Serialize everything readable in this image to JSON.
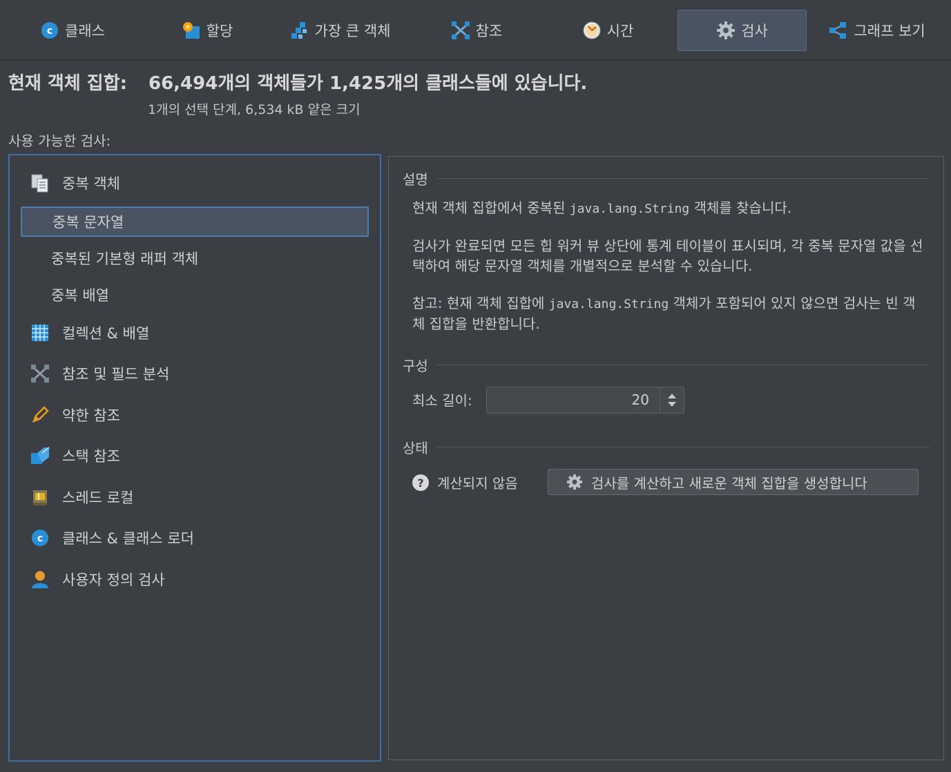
{
  "tabs": [
    {
      "label": "클래스",
      "icon": "class-c-icon",
      "active": false
    },
    {
      "label": "할당",
      "icon": "allocation-icon",
      "active": false
    },
    {
      "label": "가장 큰 객체",
      "icon": "biggest-objects-icon",
      "active": false
    },
    {
      "label": "참조",
      "icon": "references-icon",
      "active": false
    },
    {
      "label": "시간",
      "icon": "clock-icon",
      "active": false
    },
    {
      "label": "검사",
      "icon": "gear-icon",
      "active": true
    },
    {
      "label": "그래프 보기",
      "icon": "graph-icon",
      "active": false
    }
  ],
  "header": {
    "title_label": "현재 객체 집합:",
    "title_value": "66,494개의 객체들가 1,425개의 클래스들에 있습니다.",
    "subtitle": "1개의 선택 단계, 6,534 kB 얕은 크기",
    "available_label": "사용 가능한 검사:"
  },
  "inspections": {
    "groups": [
      {
        "label": "중복 객체",
        "icon": "duplicate-objects-icon"
      },
      {
        "label": "컬렉션 & 배열",
        "icon": "grid-table-icon"
      },
      {
        "label": "참조 및 필드 분석",
        "icon": "references-icon"
      },
      {
        "label": "약한 참조",
        "icon": "pencil-icon"
      },
      {
        "label": "스택 참조",
        "icon": "stack-icon"
      },
      {
        "label": "스레드 로컬",
        "icon": "thread-local-icon"
      },
      {
        "label": "클래스 & 클래스 로더",
        "icon": "class-c-icon"
      },
      {
        "label": "사용자 정의 검사",
        "icon": "user-icon"
      }
    ],
    "duplicate_children": [
      {
        "label": "중복 문자열",
        "selected": true
      },
      {
        "label": "중복된 기본형 래퍼 객체",
        "selected": false
      },
      {
        "label": "중복 배열",
        "selected": false
      }
    ]
  },
  "detail": {
    "description_title": "설명",
    "desc_p1_a": "현재 객체 집합에서 중복된 ",
    "desc_p1_code": "java.lang.String",
    "desc_p1_b": " 객체를 찾습니다.",
    "desc_p2": "검사가 완료되면 모든 힙 워커 뷰 상단에 통계 테이블이 표시되며, 각 중복 문자열 값을 선택하여 해당 문자열 객체를 개별적으로 분석할 수 있습니다.",
    "desc_p3_a": "참고: 현재 객체 집합에 ",
    "desc_p3_code": "java.lang.String",
    "desc_p3_b": " 객체가 포함되어 있지 않으면 검사는 빈 객체 집합을 반환합니다.",
    "config_title": "구성",
    "min_length_label": "최소 길이:",
    "min_length_value": "20",
    "status_title": "상태",
    "status_text": "계산되지 않음",
    "compute_button": "검사를 계산하고 새로운 객체 집합을 생성합니다"
  },
  "colors": {
    "background": "#3b3f43",
    "selection": "#4a5361",
    "selection_border": "#4f7ab2",
    "accent_blue": "#2b8fd6"
  }
}
